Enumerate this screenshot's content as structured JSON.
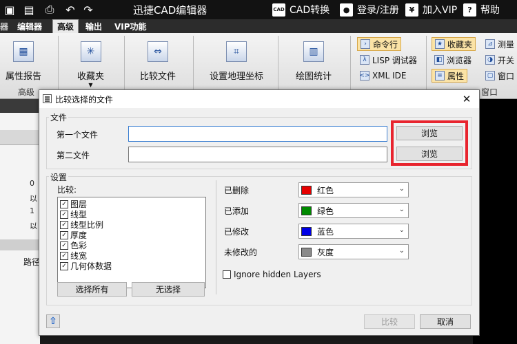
{
  "app": {
    "title": "迅捷CAD编辑器",
    "cad_convert": "CAD转换",
    "cad_icon_text": "CAD",
    "login": "登录/注册",
    "vip": "加入VIP",
    "help": "帮助",
    "yen_icon_text": "¥",
    "help_icon_text": "?"
  },
  "tabs": [
    "编辑器",
    "高级",
    "输出",
    "VIP功能"
  ],
  "tab_active": "高级",
  "ribbon": {
    "attr_report": "属性报告",
    "favorites": "收藏夹",
    "compare_files": "比较文件",
    "geo_coords": "设置地理坐标",
    "drawing_stats": "绘图统计",
    "group_advanced": "高级",
    "cmd_line": "命令行",
    "lisp_debugger": "LISP 调试器",
    "xml_ide": "XML IDE",
    "favorites_small": "收藏夹",
    "browser": "浏览器",
    "properties": "属性",
    "measure": "测量",
    "switch": "开关",
    "window": "窗口",
    "group_window": "窗口"
  },
  "left_panel": {
    "cells": [
      "0",
      "以",
      "1",
      "以"
    ],
    "path_label": "路径"
  },
  "dialog": {
    "title": "比较选择的文件",
    "close_label": "✕",
    "file_group": "文件",
    "first_file_label": "第一个文件",
    "first_file_value": "",
    "second_file_label": "第二文件",
    "second_file_value": "",
    "browse_label": "浏览",
    "settings_group": "设置",
    "compare_label": "比较:",
    "compare_items": [
      {
        "label": "图层",
        "checked": true
      },
      {
        "label": "线型",
        "checked": true
      },
      {
        "label": "线型比例",
        "checked": true
      },
      {
        "label": "厚度",
        "checked": true
      },
      {
        "label": "色彩",
        "checked": true
      },
      {
        "label": "线宽",
        "checked": true
      },
      {
        "label": "几何体数据",
        "checked": true
      }
    ],
    "select_all": "选择所有",
    "select_none": "无选择",
    "color_rows": [
      {
        "label": "已删除",
        "value": "红色",
        "color": "#e60000"
      },
      {
        "label": "已添加",
        "value": "绿色",
        "color": "#008a00"
      },
      {
        "label": "已修改",
        "value": "蓝色",
        "color": "#0000e6"
      },
      {
        "label": "未修改的",
        "value": "灰度",
        "color": "#8a8a8a"
      }
    ],
    "ignore_hidden_layers": "Ignore hidden Layers",
    "ignore_hidden_checked": false,
    "compare_button": "比较",
    "cancel_button": "取消"
  },
  "colors": {
    "highlight_box": "#e8242e",
    "title_bar": "#121212"
  }
}
